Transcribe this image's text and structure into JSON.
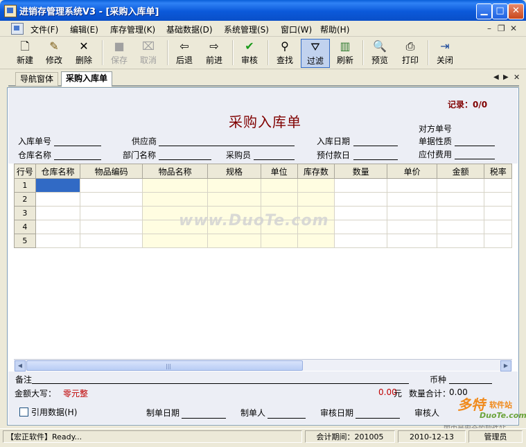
{
  "window": {
    "title": "进销存管理系统V3 - [采购入库单]",
    "minimize": "▁",
    "maximize": "□",
    "close": "✕"
  },
  "menu": {
    "items": [
      "文件(F)",
      "编辑(E)",
      "库存管理(K)",
      "基础数据(D)",
      "系统管理(S)",
      "窗口(W)",
      "帮助(H)"
    ],
    "mdi_minimize": "–",
    "mdi_restore": "❐",
    "mdi_close": "✕"
  },
  "toolbar": {
    "buttons": [
      {
        "label": "新建",
        "icon": "new-doc-icon",
        "glyph": "🗋",
        "enabled": true
      },
      {
        "label": "修改",
        "icon": "edit-icon",
        "glyph": "✎",
        "enabled": true
      },
      {
        "label": "删除",
        "icon": "delete-icon",
        "glyph": "✕",
        "enabled": true
      },
      {
        "label": "保存",
        "icon": "save-icon",
        "glyph": "■",
        "enabled": false
      },
      {
        "label": "取消",
        "icon": "cancel-icon",
        "glyph": "⌧",
        "enabled": false
      },
      {
        "label": "后退",
        "icon": "back-icon",
        "glyph": "⇦",
        "enabled": true
      },
      {
        "label": "前进",
        "icon": "forward-icon",
        "glyph": "⇨",
        "enabled": true
      },
      {
        "label": "审核",
        "icon": "check-icon",
        "glyph": "✔",
        "enabled": true
      },
      {
        "label": "查找",
        "icon": "binoculars-icon",
        "glyph": "⚲",
        "enabled": true
      },
      {
        "label": "过滤",
        "icon": "filter-icon",
        "glyph": "⛛",
        "enabled": true,
        "active": true
      },
      {
        "label": "刷新",
        "icon": "refresh-icon",
        "glyph": "▥",
        "enabled": true
      },
      {
        "label": "预览",
        "icon": "preview-icon",
        "glyph": "🔍",
        "enabled": true
      },
      {
        "label": "打印",
        "icon": "print-icon",
        "glyph": "⎙",
        "enabled": true
      },
      {
        "label": "关闭",
        "icon": "close-door-icon",
        "glyph": "⇥",
        "enabled": true
      }
    ]
  },
  "tabs": {
    "items": [
      "导航窗体",
      "采购入库单"
    ],
    "active": "采购入库单",
    "left_arrow": "◀",
    "right_arrow": "▶",
    "close": "✕"
  },
  "form": {
    "record": "记录：0/0",
    "title": "采购入库单",
    "fields": {
      "order_no": "入库单号",
      "supplier": "供应商",
      "in_date": "入库日期",
      "counter_no": "对方单号",
      "doc_type": "单据性质",
      "warehouse": "仓库名称",
      "department": "部门名称",
      "buyer": "采购员",
      "prepaid": "预付款日",
      "payable": "应付费用"
    },
    "grid": {
      "columns": [
        "行号",
        "仓库名称",
        "物品编码",
        "物品名称",
        "规格",
        "单位",
        "库存数",
        "数量",
        "单价",
        "金额",
        "税率"
      ],
      "rows": [
        "1",
        "2",
        "3",
        "4",
        "5"
      ]
    },
    "remark_label": "备注",
    "currency_label": "币种",
    "amount_upper_label": "金额大写：",
    "amount_upper_value": "零元整",
    "amount_value": "0.00",
    "amount_unit": "元",
    "qty_total_label": "数量合计：",
    "qty_total_value": "0.00",
    "cite_data": "引用数据(H)",
    "make_date": "制单日期",
    "maker": "制单人",
    "audit_date": "审核日期",
    "auditor": "审核人",
    "watermark": "www.DuoTe.com"
  },
  "status": {
    "ready": "【宏正软件】Ready...",
    "period": "会计期间：201005",
    "date": "2010-12-13",
    "user": "管理员"
  },
  "logo": {
    "brand": "多特",
    "brand_suffix": "软件站",
    "site": "DuoTe.com",
    "slogan": "国内最安全的软件站"
  },
  "colors": {
    "titlebar": "#0A5FD8",
    "form_title": "#800000",
    "selected_cell": "#316AC5",
    "yellow_cells": "#FFFDE1",
    "amount_red": "#c00000"
  }
}
